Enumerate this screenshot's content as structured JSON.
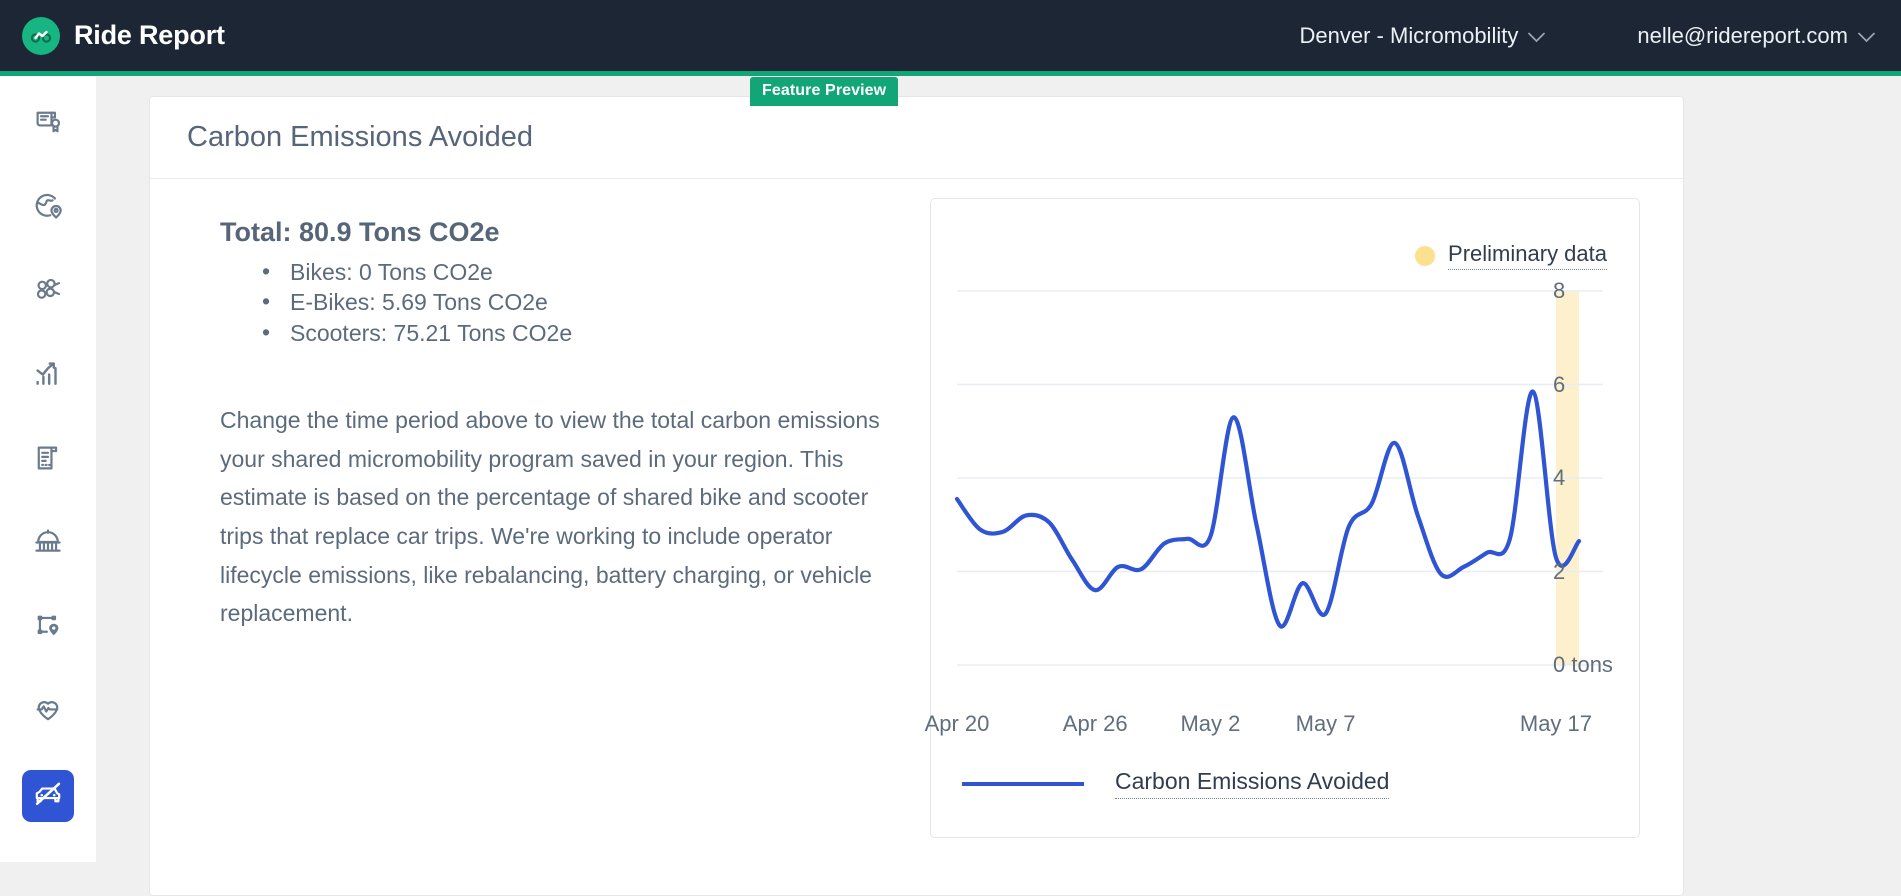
{
  "topbar": {
    "brand_name": "Ride Report",
    "logo_icon": "bike-circle-logo",
    "region_label": "Denver - Micromobility",
    "region_chevron": "chevron-down-icon",
    "user_email": "nelle@ridereport.com",
    "user_chevron": "chevron-down-icon",
    "background_color": "#1c2635",
    "accent_color": "#12a676"
  },
  "sidebar": {
    "items": [
      {
        "icon": "permit-scroll-icon",
        "active": false
      },
      {
        "icon": "globe-pin-icon",
        "active": false
      },
      {
        "icon": "vehicle-cluster-icon",
        "active": false
      },
      {
        "icon": "bar-chart-trend-icon",
        "active": false
      },
      {
        "icon": "report-document-icon",
        "active": false
      },
      {
        "icon": "policy-government-icon",
        "active": false
      },
      {
        "icon": "geofence-area-pin-icon",
        "active": false
      },
      {
        "icon": "health-pulse-heart-icon",
        "active": false
      },
      {
        "icon": "car-free-icon",
        "active": true
      }
    ],
    "active_background": "#2f55d4",
    "icon_color": "#6b7b8d"
  },
  "card": {
    "title": "Carbon Emissions Avoided",
    "badge_label": "Feature Preview",
    "badge_color": "#12a676"
  },
  "summary": {
    "total_label": "Total: 80.9 Tons CO2e",
    "breakdown": [
      "Bikes: 0 Tons CO2e",
      "E-Bikes: 5.69 Tons CO2e",
      "Scooters: 75.21 Tons CO2e"
    ],
    "description": "Change the time period above to view the total carbon emissions your shared micromobility program saved in your region. This estimate is based on the percentage of shared bike and scooter trips that replace car trips. We're working to include operator lifecycle emissions, like rebalancing, battery charging, or vehicle replacement."
  },
  "chart_panel": {
    "preliminary_legend_label": "Preliminary data",
    "preliminary_dot_color": "#fbe08e",
    "series_legend_label": "Carbon Emissions Avoided",
    "series_color": "#2f55d4"
  },
  "chart_data": {
    "type": "line",
    "title": "Carbon Emissions Avoided",
    "xlabel": "",
    "ylabel": "tons",
    "ylim": [
      0,
      8
    ],
    "yticks": [
      0,
      2,
      4,
      6,
      8
    ],
    "ytick_labels": [
      "0 tons",
      "2",
      "4",
      "6",
      "8"
    ],
    "grid": true,
    "legend_position": "bottom-left",
    "x_tick_labels": [
      "Apr 20",
      "Apr 26",
      "May 2",
      "May 7",
      "May 17"
    ],
    "x_tick_indices": [
      0,
      6,
      11,
      16,
      26
    ],
    "x": [
      "Apr 20",
      "Apr 21",
      "Apr 22",
      "Apr 23",
      "Apr 24",
      "Apr 25",
      "Apr 26",
      "Apr 27",
      "Apr 28",
      "Apr 29",
      "Apr 30",
      "May 2",
      "May 3",
      "May 4",
      "May 5",
      "May 6",
      "May 7",
      "May 8",
      "May 9",
      "May 10",
      "May 11",
      "May 12",
      "May 13",
      "May 14",
      "May 15",
      "May 16",
      "May 17",
      "May 18"
    ],
    "series": [
      {
        "name": "Carbon Emissions Avoided",
        "color": "#2f55d4",
        "values": [
          3.55,
          2.9,
          2.85,
          3.2,
          3.05,
          2.25,
          1.6,
          2.1,
          2.05,
          2.6,
          2.7,
          2.75,
          5.3,
          3.0,
          0.85,
          1.75,
          1.1,
          2.95,
          3.45,
          4.75,
          3.2,
          1.95,
          2.1,
          2.4,
          2.7,
          5.85,
          2.3,
          2.65
        ]
      }
    ],
    "annotations": [
      {
        "type": "band",
        "label": "Preliminary data",
        "color": "#fdf1cd",
        "x_start_index": 26,
        "x_end_index": 27
      }
    ]
  }
}
